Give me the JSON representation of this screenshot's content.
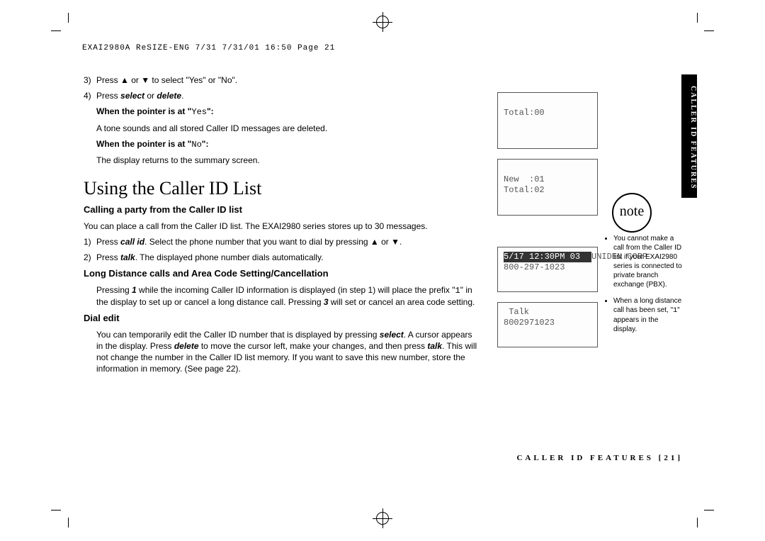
{
  "header": "EXAI2980A ReSIZE-ENG 7/31  7/31/01  16:50  Page 21",
  "steps_top": {
    "s3": "Press ▲ or ▼ to select \"Yes\" or \"No\".",
    "s4_pre": "Press ",
    "s4_a": "select",
    "s4_mid": " or ",
    "s4_b": "delete",
    "s4_post": ".",
    "yes_hdr_pre": "When the pointer is at \"",
    "yes_hdr_val": "Yes",
    "yes_hdr_post": "\":",
    "yes_body": "A tone sounds and all stored Caller ID messages are deleted.",
    "no_hdr_pre": "When the pointer is at \"",
    "no_hdr_val": "No",
    "no_hdr_post": "\":",
    "no_body": "The display returns to the summary screen."
  },
  "section_title": "Using the Caller ID List",
  "calling_hdr": "Calling a party from the Caller ID list",
  "calling_intro": "You can place a call from the Caller ID list. The EXAI2980 series stores up to 30 messages.",
  "calling_s1_pre": "Press ",
  "calling_s1_b": "call id",
  "calling_s1_post": ". Select the phone number that you want to dial by pressing ▲ or ▼.",
  "calling_s2_pre": "Press ",
  "calling_s2_b": "talk",
  "calling_s2_post": ". The displayed phone number dials automatically.",
  "long_hdr": "Long Distance calls and Area Code Setting/Cancellation",
  "long_body_pre": "Pressing ",
  "long_body_k1": "1",
  "long_body_mid1": " while the incoming Caller ID information is displayed (in step 1) will place the prefix \"",
  "long_body_k2": "1",
  "long_body_mid2": "\" in the display to set up or cancel a long distance call. Pressing ",
  "long_body_k3": "3",
  "long_body_end": " will set or cancel an area code setting.",
  "dial_hdr": "Dial edit",
  "dial_body_p1": "You can temporarily edit the Caller ID number that is displayed by pressing ",
  "dial_body_b1": "select",
  "dial_body_p2": ". A cursor appears in the display. Press ",
  "dial_body_b2": "delete",
  "dial_body_p3": " to move the cursor left, make your changes, and then press ",
  "dial_body_b3": "talk",
  "dial_body_p4": ". This will not change the number in the Caller ID list memory. If you want to save this new number, store the information in memory. (See page 22).",
  "lcd1": "\nTotal:00\n\n\n",
  "lcd2": "\nNew  :01\nTotal:02\n\n",
  "lcd3_line1": "5/17 12:30PM 03",
  "lcd3_line2": "UNIDEN CORP",
  "lcd3_line3": "800-297-1023",
  "lcd4": " Talk\n8002971023\n\n",
  "note_label": "note",
  "note1": "You cannot make a call from the Caller ID list if your EXAI2980 series is connected to private branch exchange (PBX).",
  "note2_pre": "When a long distance call has been set, \"",
  "note2_val": "1",
  "note2_post": "\" appears in the display.",
  "side_tab": "CALLER ID FEATURES",
  "footer": "CALLER ID FEATURES  [21]"
}
